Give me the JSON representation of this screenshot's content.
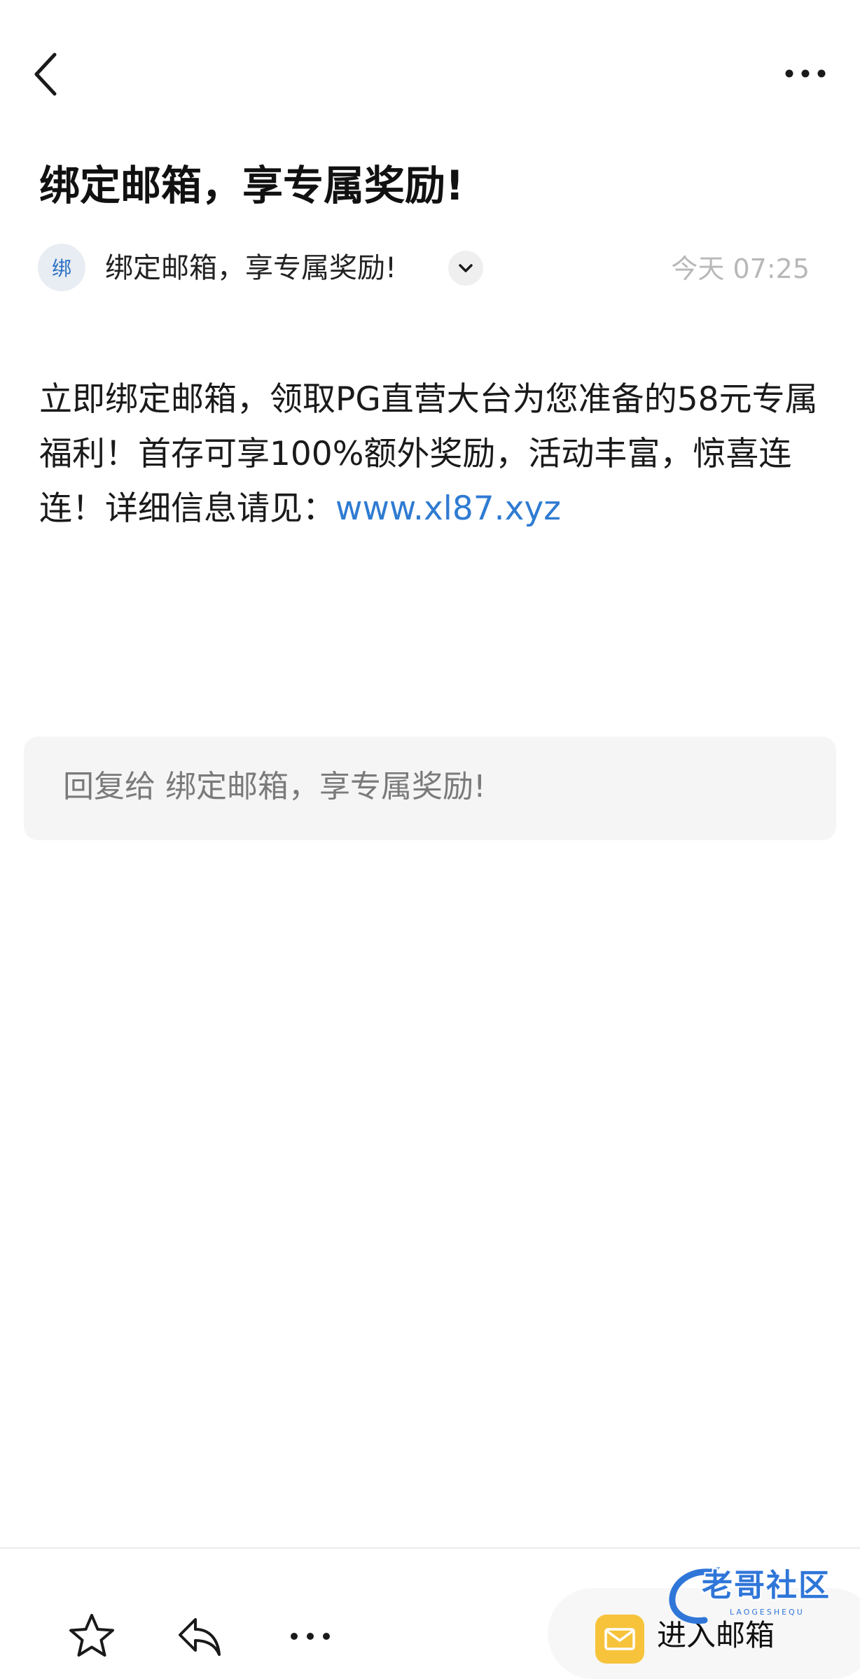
{
  "topbar": {
    "back_icon": "chevron-left-icon",
    "more_icon": "more-horizontal-icon"
  },
  "email": {
    "subject": "绑定邮箱，享专属奖励!",
    "sender": {
      "avatar_char": "绑",
      "name": "绑定邮箱，享专属奖励!",
      "expand_icon": "chevron-down-icon"
    },
    "timestamp": "今天 07:25",
    "body_text": "立即绑定邮箱，领取PG直营大台为您准备的58元专属福利！首存可享100%额外奖励，活动丰富，惊喜连连！详细信息请见：",
    "body_link": "www.xl87.xyz"
  },
  "reply": {
    "placeholder": "回复给 绑定邮箱，享专属奖励!"
  },
  "bottom_bar": {
    "star_icon": "star-outline-icon",
    "reply_icon": "reply-icon",
    "more_icon": "more-horizontal-icon",
    "enter_mailbox_label": "进入邮箱",
    "mail_app_icon": "mail-app-icon"
  },
  "watermark": {
    "text": "老哥社区",
    "sub": "LAOGESHEQU"
  },
  "colors": {
    "link": "#2f7bd2",
    "timestamp": "#b8b8b8",
    "reply_box_bg": "#f5f5f5",
    "mail_icon_bg": "#f6c33b"
  }
}
